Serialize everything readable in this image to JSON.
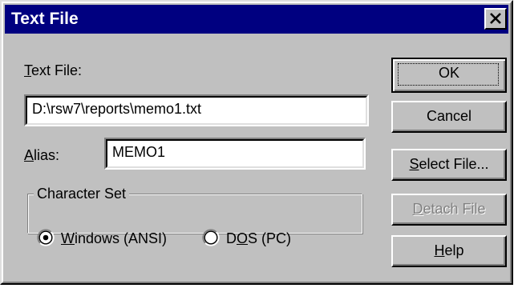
{
  "window": {
    "title": "Text File",
    "close_icon": "close-icon"
  },
  "text_file": {
    "label_prefix": "T",
    "label_rest": "ext File:",
    "value": "D:\\rsw7\\reports\\memo1.txt"
  },
  "alias": {
    "label_prefix": "A",
    "label_rest": "lias:",
    "value": "MEMO1"
  },
  "character_set": {
    "title": "Character Set",
    "options": [
      {
        "label_prefix": "W",
        "label_rest": "indows (ANSI)",
        "selected": true
      },
      {
        "label_pre": "D",
        "label_prefix": "O",
        "label_rest": "S (PC)",
        "selected": false
      }
    ]
  },
  "buttons": {
    "ok": "OK",
    "cancel": "Cancel",
    "select_file_prefix": "S",
    "select_file_rest": "elect File...",
    "detach_file_prefix": "D",
    "detach_file_rest": "etach File",
    "help_prefix": "H",
    "help_rest": "elp"
  },
  "colors": {
    "titlebar": "#000080",
    "face": "#c0c0c0",
    "disabled_text": "#808080"
  }
}
